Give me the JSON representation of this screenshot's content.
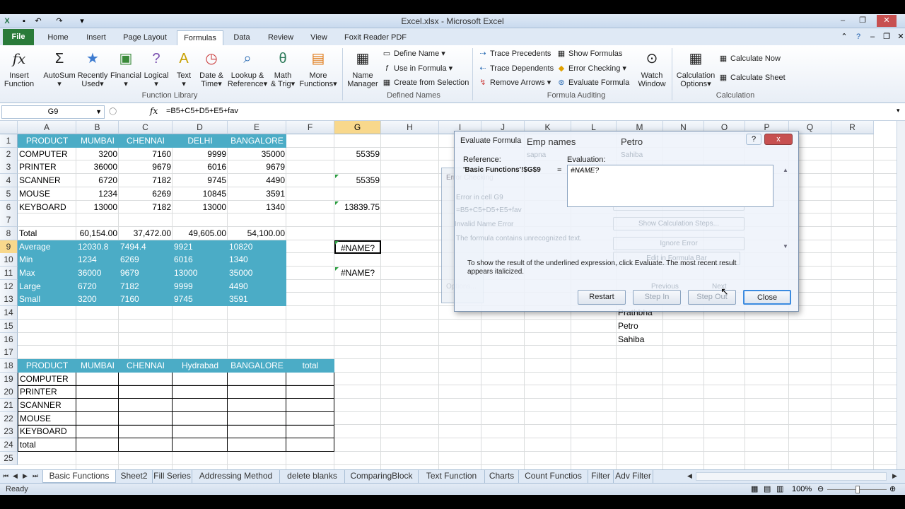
{
  "window": {
    "title": "Excel.xlsx - Microsoft Excel"
  },
  "ribbon_tabs": [
    "File",
    "Home",
    "Insert",
    "Page Layout",
    "Formulas",
    "Data",
    "Review",
    "View",
    "Foxit Reader PDF"
  ],
  "ribbon": {
    "insert_function": [
      "Insert",
      "Function"
    ],
    "autosum": "AutoSum",
    "recently_used": [
      "Recently",
      "Used"
    ],
    "financial": "Financial",
    "logical": "Logical",
    "text": "Text",
    "date_time": [
      "Date &",
      "Time"
    ],
    "lookup": [
      "Lookup &",
      "Reference"
    ],
    "math": [
      "Math",
      "& Trig"
    ],
    "more": [
      "More",
      "Functions"
    ],
    "name_manager": [
      "Name",
      "Manager"
    ],
    "define_name": "Define Name",
    "use_in_formula": "Use in Formula",
    "create_from_selection": "Create from Selection",
    "trace_precedents": "Trace Precedents",
    "trace_dependents": "Trace Dependents",
    "remove_arrows": "Remove Arrows",
    "show_formulas": "Show Formulas",
    "error_checking": "Error Checking",
    "evaluate_formula": "Evaluate Formula",
    "watch_window": [
      "Watch",
      "Window"
    ],
    "calc_options": [
      "Calculation",
      "Options"
    ],
    "calc_now": "Calculate Now",
    "calc_sheet": "Calculate Sheet",
    "groups": {
      "function_library": "Function Library",
      "defined_names": "Defined Names",
      "formula_auditing": "Formula Auditing",
      "calculation": "Calculation"
    }
  },
  "formula_bar": {
    "name_box": "G9",
    "fx": "fx",
    "formula": "=B5+C5+D5+E5+fav"
  },
  "columns": [
    "A",
    "B",
    "C",
    "D",
    "E",
    "F",
    "G",
    "H",
    "I",
    "J",
    "K",
    "L",
    "M",
    "N",
    "O",
    "P",
    "Q",
    "R"
  ],
  "rows": [
    "1",
    "2",
    "3",
    "4",
    "5",
    "6",
    "7",
    "8",
    "9",
    "10",
    "11",
    "12",
    "13",
    "14",
    "15",
    "16",
    "17",
    "18",
    "19",
    "20",
    "21",
    "22",
    "23",
    "24",
    "25"
  ],
  "table1": {
    "headers": [
      "PRODUCT",
      "MUMBAI",
      "CHENNAI",
      "DELHI",
      "BANGALORE"
    ],
    "rows": [
      [
        "COMPUTER",
        "3200",
        "7160",
        "9999",
        "35000"
      ],
      [
        "PRINTER",
        "36000",
        "9679",
        "6016",
        "9679"
      ],
      [
        "SCANNER",
        "6720",
        "7182",
        "9745",
        "4490"
      ],
      [
        "MOUSE",
        "1234",
        "6269",
        "10845",
        "3591"
      ],
      [
        "KEYBOARD",
        "13000",
        "7182",
        "13000",
        "1340"
      ]
    ],
    "total": [
      "Total",
      "60,154.00",
      "37,472.00",
      "49,605.00",
      "54,100.00"
    ],
    "stats": [
      [
        "Average",
        "12030.8",
        "7494.4",
        "9921",
        "10820"
      ],
      [
        "Min",
        "1234",
        "6269",
        "6016",
        "1340"
      ],
      [
        "Max",
        "36000",
        "9679",
        "13000",
        "35000"
      ],
      [
        "Large",
        "6720",
        "7182",
        "9999",
        "4490"
      ],
      [
        "Small",
        "3200",
        "7160",
        "9745",
        "3591"
      ]
    ]
  },
  "g_column": {
    "g2": "55359",
    "g4": "55359",
    "g6": "13839.75",
    "g9": "#NAME?",
    "g11": "#NAME?"
  },
  "table2": {
    "headers": [
      "PRODUCT",
      "MUMBAI",
      "CHENNAI",
      "Hydrabad",
      "BANGALORE",
      "total"
    ],
    "rows": [
      "COMPUTER",
      "PRINTER",
      "SCANNER",
      "MOUSE",
      "KEYBOARD",
      "total"
    ]
  },
  "m_column": {
    "m1": "Petro",
    "m14": "Prathbha",
    "m15": "Petro",
    "m16": "Sahiba"
  },
  "dialog": {
    "title": "Evaluate Formula",
    "overlay_title": "Emp names",
    "help": "?",
    "close_x": "x",
    "reference_label": "Reference:",
    "reference_value": "'Basic Functions'!$G$9",
    "equals": "=",
    "evaluation_label": "Evaluation:",
    "evaluation_value": "#NAME?",
    "info": "To show the result of the underlined expression, click Evaluate.  The most recent result appears italicized.",
    "buttons": {
      "restart": "Restart",
      "step_in": "Step In",
      "step_out": "Step Out",
      "close": "Close"
    },
    "ghost": {
      "title": "Error Checking",
      "line1": "Error in cell G9",
      "line2": "=B5+C5+D5+E5+fav",
      "line3": "Invalid Name Error",
      "line4": "The formula contains unrecognized text.",
      "btn1": "Help on this error",
      "btn2": "Show Calculation Steps...",
      "btn3": "Ignore Error",
      "btn4": "Edit in Formula Bar",
      "options": "Options...",
      "previous": "Previous",
      "next": "Next",
      "sapna": "sapna",
      "sahiba": "Sahiba"
    }
  },
  "sheet_tabs": [
    "Basic Functions",
    "Sheet2",
    "Fill Series",
    "Addressing Method",
    "delete blanks",
    "ComparingBlock",
    "Text Function",
    "Charts",
    "Count Functios",
    "Filter",
    "Adv Filter"
  ],
  "status": {
    "ready": "Ready",
    "zoom": "100%"
  }
}
